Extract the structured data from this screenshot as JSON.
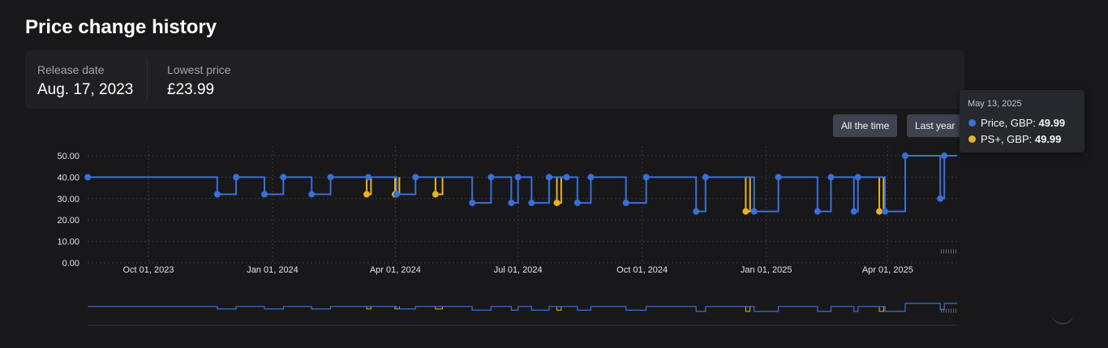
{
  "title": "Price change history",
  "info": {
    "release_label": "Release date",
    "release_value": "Aug. 17, 2023",
    "lowest_label": "Lowest price",
    "lowest_value": "£23.99"
  },
  "range_buttons": {
    "all_label": "All the time",
    "year_label": "Last year"
  },
  "tooltip": {
    "date": "May 13, 2025",
    "rows": [
      {
        "label": "Price, GBP: ",
        "value": "49.99",
        "color": "#3b6fd8"
      },
      {
        "label": "PS+, GBP: ",
        "value": "49.99",
        "color": "#e6b422"
      }
    ]
  },
  "colors": {
    "price": "#3b6fd8",
    "psplus": "#e6b422",
    "grid": "#3a3a40",
    "axis_text": "#e4e4e7"
  },
  "chart_data": {
    "type": "line",
    "step": true,
    "x_axis": "date",
    "ylim": [
      0,
      50
    ],
    "yticks": [
      "0.00",
      "10.00",
      "20.00",
      "30.00",
      "40.00",
      "50.00"
    ],
    "xticks": [
      "Oct 01, 2023",
      "Jan 01, 2024",
      "Apr 01, 2024",
      "Jul 01, 2024",
      "Oct 01, 2024",
      "Jan 01, 2025",
      "Apr 01, 2025"
    ],
    "grid": true,
    "series": [
      {
        "name": "Price, GBP",
        "points": [
          [
            "2023-08-17",
            39.99
          ],
          [
            "2023-11-21",
            31.99
          ],
          [
            "2023-12-05",
            39.99
          ],
          [
            "2023-12-26",
            31.99
          ],
          [
            "2024-01-09",
            39.99
          ],
          [
            "2024-01-30",
            31.99
          ],
          [
            "2024-02-13",
            39.99
          ],
          [
            "2024-03-12",
            39.99
          ],
          [
            "2024-04-02",
            31.99
          ],
          [
            "2024-04-16",
            39.99
          ],
          [
            "2024-05-28",
            27.99
          ],
          [
            "2024-06-11",
            39.99
          ],
          [
            "2024-06-26",
            27.99
          ],
          [
            "2024-07-01",
            39.99
          ],
          [
            "2024-07-11",
            27.99
          ],
          [
            "2024-07-24",
            39.99
          ],
          [
            "2024-08-06",
            39.99
          ],
          [
            "2024-08-14",
            27.99
          ],
          [
            "2024-08-24",
            39.99
          ],
          [
            "2024-09-19",
            27.99
          ],
          [
            "2024-10-04",
            39.99
          ],
          [
            "2024-11-10",
            23.99
          ],
          [
            "2024-11-17",
            39.99
          ],
          [
            "2024-12-23",
            23.99
          ],
          [
            "2025-01-10",
            39.99
          ],
          [
            "2025-02-08",
            23.99
          ],
          [
            "2025-02-18",
            39.99
          ],
          [
            "2025-03-07",
            23.99
          ],
          [
            "2025-03-10",
            39.99
          ],
          [
            "2025-03-30",
            23.99
          ],
          [
            "2025-04-14",
            49.99
          ],
          [
            "2025-05-10",
            29.99
          ],
          [
            "2025-05-13",
            49.99
          ]
        ]
      },
      {
        "name": "PS+, GBP",
        "points": [
          [
            "2024-03-12",
            31.99
          ],
          [
            "2024-03-14",
            39.99
          ],
          [
            "2024-04-02",
            31.99
          ],
          [
            "2024-04-04",
            39.99
          ],
          [
            "2024-05-02",
            31.99
          ],
          [
            "2024-05-06",
            39.99
          ],
          [
            "2024-07-31",
            27.99
          ],
          [
            "2024-08-02",
            39.99
          ],
          [
            "2024-12-18",
            23.99
          ],
          [
            "2024-12-20",
            39.99
          ],
          [
            "2025-03-27",
            23.99
          ],
          [
            "2025-03-29",
            39.99
          ]
        ]
      }
    ]
  }
}
